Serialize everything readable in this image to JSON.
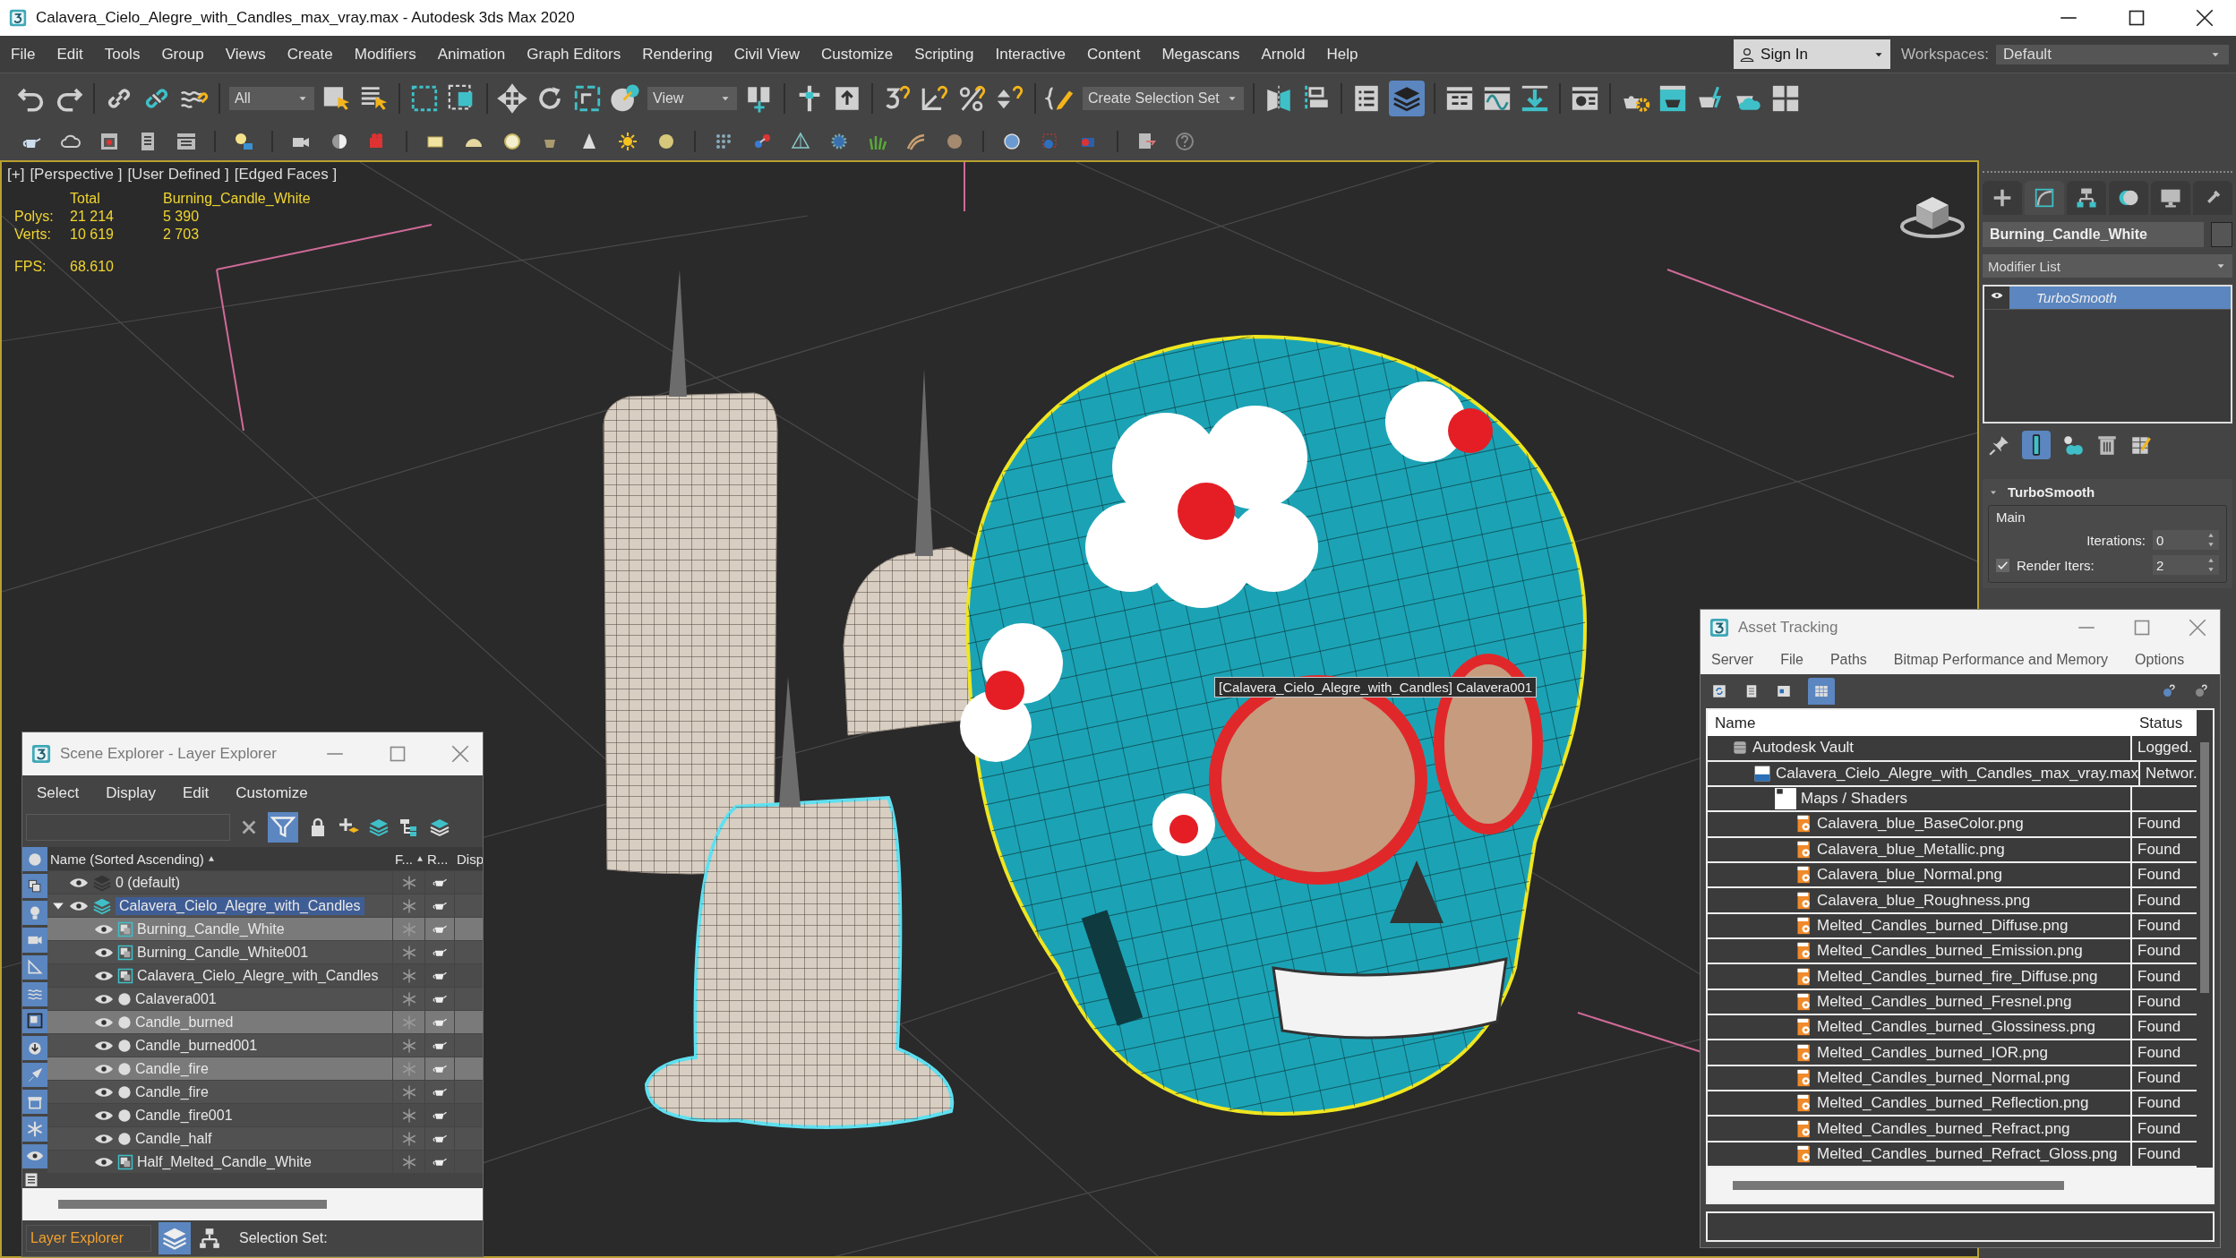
{
  "window": {
    "title": "Calavera_Cielo_Alegre_with_Candles_max_vray.max - Autodesk 3ds Max 2020"
  },
  "menu": [
    "File",
    "Edit",
    "Tools",
    "Group",
    "Views",
    "Create",
    "Modifiers",
    "Animation",
    "Graph Editors",
    "Rendering",
    "Civil View",
    "Customize",
    "Scripting",
    "Interactive",
    "Content",
    "Megascans",
    "Arnold",
    "Help"
  ],
  "account": {
    "label": "Sign In"
  },
  "workspaces": {
    "label": "Workspaces:",
    "value": "Default"
  },
  "toolbar": {
    "selection_filter": "All",
    "reference_coord": "View",
    "selection_set": "Create Selection Set",
    "layer_explorer_active": true
  },
  "viewport": {
    "labels": [
      "[+]",
      "[Perspective ]",
      "[User Defined ]",
      "[Edged Faces ]"
    ],
    "stats": {
      "header": [
        "Total",
        "Burning_Candle_White"
      ],
      "rows": [
        {
          "label": "Polys:",
          "total": "21 214",
          "object": "5 390"
        },
        {
          "label": "Verts:",
          "total": "10 619",
          "object": "2 703"
        }
      ],
      "fps_label": "FPS:",
      "fps": "68.610"
    },
    "tooltip": "[Calavera_Cielo_Alegre_with_Candles] Calavera001"
  },
  "scene_explorer": {
    "title": "Scene Explorer - Layer Explorer",
    "menu": [
      "Select",
      "Display",
      "Edit",
      "Customize"
    ],
    "filter_active": true,
    "columns": [
      "Name (Sorted Ascending)",
      "F...",
      "R...",
      "Disp"
    ],
    "layers": [
      {
        "name": "0 (default)",
        "kind": "layer",
        "current": false,
        "selected": false
      },
      {
        "name": "Calavera_Cielo_Alegre_with_Candles",
        "kind": "layer",
        "current": true,
        "selected": false,
        "expanded": true,
        "children": [
          {
            "name": "Burning_Candle_White",
            "kind": "group",
            "selected": true
          },
          {
            "name": "Burning_Candle_White001",
            "kind": "group",
            "selected": false
          },
          {
            "name": "Calavera_Cielo_Alegre_with_Candles",
            "kind": "group",
            "selected": false
          },
          {
            "name": "Calavera001",
            "kind": "object",
            "selected": false
          },
          {
            "name": "Candle_burned",
            "kind": "object",
            "selected": true
          },
          {
            "name": "Candle_burned001",
            "kind": "object",
            "selected": false
          },
          {
            "name": "Candle_fire",
            "kind": "object",
            "selected": true
          },
          {
            "name": "Candle_fire",
            "kind": "object",
            "selected": false
          },
          {
            "name": "Candle_fire001",
            "kind": "object",
            "selected": false
          },
          {
            "name": "Candle_half",
            "kind": "object",
            "selected": false
          },
          {
            "name": "Half_Melted_Candle_White",
            "kind": "group",
            "selected": false
          }
        ]
      }
    ],
    "explorer_name": "Layer Explorer",
    "layer_mode_active": true,
    "selection_set_label": "Selection Set:"
  },
  "asset_tracking": {
    "title": "Asset Tracking",
    "menu": [
      "Server",
      "File",
      "Paths",
      "Bitmap Performance and Memory",
      "Options"
    ],
    "table_view_active": true,
    "columns": [
      "Name",
      "Status"
    ],
    "tree": [
      {
        "name": "Autodesk Vault",
        "kind": "vault",
        "status": "Logged.",
        "children": [
          {
            "name": "Calavera_Cielo_Alegre_with_Candles_max_vray.max",
            "kind": "scene",
            "status": "Networ.",
            "children": [
              {
                "name": "Maps / Shaders",
                "kind": "folder",
                "children": [
                  {
                    "name": "Calavera_blue_BaseColor.png",
                    "kind": "bitmap",
                    "status": "Found"
                  },
                  {
                    "name": "Calavera_blue_Metallic.png",
                    "kind": "bitmap",
                    "status": "Found"
                  },
                  {
                    "name": "Calavera_blue_Normal.png",
                    "kind": "bitmap",
                    "status": "Found"
                  },
                  {
                    "name": "Calavera_blue_Roughness.png",
                    "kind": "bitmap",
                    "status": "Found"
                  },
                  {
                    "name": "Melted_Candles_burned_Diffuse.png",
                    "kind": "bitmap",
                    "status": "Found"
                  },
                  {
                    "name": "Melted_Candles_burned_Emission.png",
                    "kind": "bitmap",
                    "status": "Found"
                  },
                  {
                    "name": "Melted_Candles_burned_fire_Diffuse.png",
                    "kind": "bitmap",
                    "status": "Found"
                  },
                  {
                    "name": "Melted_Candles_burned_Fresnel.png",
                    "kind": "bitmap",
                    "status": "Found"
                  },
                  {
                    "name": "Melted_Candles_burned_Glossiness.png",
                    "kind": "bitmap",
                    "status": "Found"
                  },
                  {
                    "name": "Melted_Candles_burned_IOR.png",
                    "kind": "bitmap",
                    "status": "Found"
                  },
                  {
                    "name": "Melted_Candles_burned_Normal.png",
                    "kind": "bitmap",
                    "status": "Found"
                  },
                  {
                    "name": "Melted_Candles_burned_Reflection.png",
                    "kind": "bitmap",
                    "status": "Found"
                  },
                  {
                    "name": "Melted_Candles_burned_Refract.png",
                    "kind": "bitmap",
                    "status": "Found"
                  },
                  {
                    "name": "Melted_Candles_burned_Refract_Gloss.png",
                    "kind": "bitmap",
                    "status": "Found"
                  }
                ]
              }
            ]
          }
        ]
      }
    ]
  },
  "command_panel": {
    "tabs": [
      {
        "kind": "create",
        "selected": false
      },
      {
        "kind": "modify",
        "selected": true
      },
      {
        "kind": "hierarchy",
        "selected": false
      },
      {
        "kind": "motion",
        "selected": false
      },
      {
        "kind": "display",
        "selected": false
      },
      {
        "kind": "utilities",
        "selected": false
      }
    ],
    "object_name": "Burning_Candle_White",
    "modifier_list": "Modifier List",
    "stack": [
      {
        "name": "TurboSmooth",
        "selected": true
      }
    ],
    "show_end_result": true,
    "rollout": {
      "title": "TurboSmooth",
      "expanded": true,
      "group": "Main",
      "iterations": {
        "label": "Iterations:",
        "value": "0"
      },
      "render_iters": {
        "label": "Render Iters:",
        "checked": true,
        "value": "2"
      }
    }
  }
}
